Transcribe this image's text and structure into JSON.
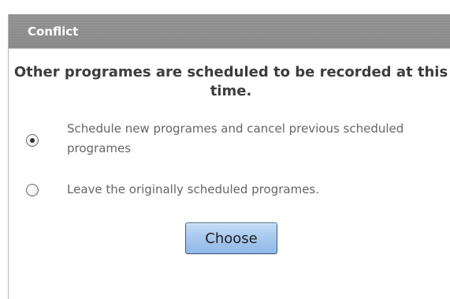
{
  "dialog": {
    "title": "Conflict",
    "message": "Other programes are scheduled to be recorded at this time.",
    "options": [
      {
        "label": "Schedule new programes and cancel previous scheduled programes",
        "checked": true
      },
      {
        "label": "Leave the originally scheduled programes.",
        "checked": false
      }
    ],
    "choose_label": "Choose"
  }
}
